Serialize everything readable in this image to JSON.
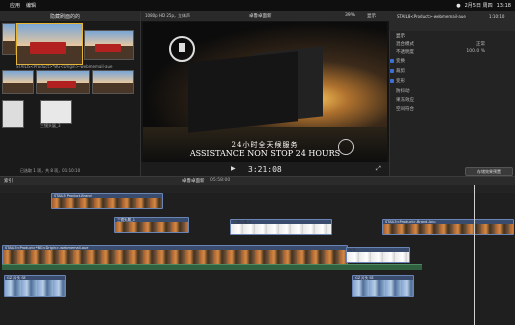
{
  "menubar": {
    "apple": "",
    "items": [
      "应用",
      "编辑"
    ],
    "right_items": [
      "2月5日 周四",
      "13:18"
    ]
  },
  "browser": {
    "title": "隐藏刷面的的",
    "clips": [
      {
        "label": "STAILIS<Product>*BG<Drigin>-webmemail-aue"
      },
      {
        "label": "三镜头展_3"
      }
    ],
    "status": "已选取 1 项，共 8 项，01:10:10"
  },
  "viewer": {
    "header_left": "1080p HD 25p，立体声",
    "header_center": "卓鲁卓面新",
    "zoom": "39%",
    "display": "显示",
    "caption_cn": "24小时全天候服务",
    "caption_en": "ASSISTANCE NON STOP 24 HOURS",
    "timecode": "3:21:08"
  },
  "inspector": {
    "header_file": "STAIL8<Product>-webmemail-aue",
    "header_time": "1:10:10",
    "section": "显示",
    "rows": [
      {
        "label": "混合模式",
        "value": "正常"
      },
      {
        "label": "不透明度",
        "value": "100.0 %"
      }
    ],
    "options": [
      "变换",
      "裁剪",
      "变形",
      "防抖动",
      "果冻效应",
      "空间符合"
    ],
    "save_button": "存储效果预置"
  },
  "timeline": {
    "index": "索引",
    "project": "卓鲁卓面新",
    "duration": "05:58:00",
    "clips": [
      {
        "label": "STAIL5 Product-Brand"
      },
      {
        "label": "三镜头展_1"
      },
      {
        "label": "三镜头展_2"
      },
      {
        "label": "STAIL5<Product>-Brand-Anu"
      },
      {
        "label": "STAIL5<Product>*BG<Drigin>-webmemail-aue"
      },
      {
        "label": "片头"
      },
      {
        "label": "GZ 片头 SE"
      },
      {
        "label": "GZ 片头 SE"
      }
    ]
  }
}
